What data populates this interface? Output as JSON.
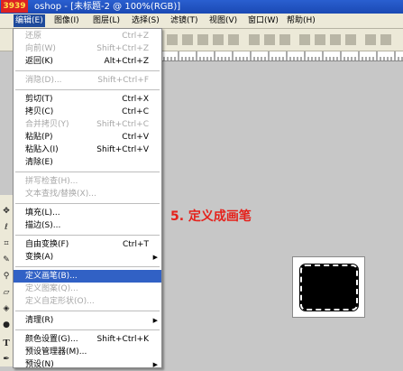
{
  "window": {
    "badge": "3939",
    "title": "oshop - [未标题-2 @ 100%(RGB)]"
  },
  "menubar": [
    {
      "label": "编辑(E)",
      "active": true
    },
    {
      "label": "图像(I)"
    },
    {
      "label": "图层(L)"
    },
    {
      "label": "选择(S)"
    },
    {
      "label": "滤镜(T)"
    },
    {
      "label": "视图(V)"
    },
    {
      "label": "窗口(W)"
    },
    {
      "label": "帮助(H)"
    }
  ],
  "edit_menu": {
    "items": [
      {
        "label": "还原",
        "shortcut": "Ctrl+Z",
        "disabled": true
      },
      {
        "label": "向前(W)",
        "shortcut": "Shift+Ctrl+Z",
        "disabled": true
      },
      {
        "label": "返回(K)",
        "shortcut": "Alt+Ctrl+Z"
      },
      {
        "label": "消隐(D)...",
        "shortcut": "Shift+Ctrl+F",
        "disabled": true
      },
      {
        "label": "剪切(T)",
        "shortcut": "Ctrl+X"
      },
      {
        "label": "拷贝(C)",
        "shortcut": "Ctrl+C"
      },
      {
        "label": "合并拷贝(Y)",
        "shortcut": "Shift+Ctrl+C",
        "disabled": true
      },
      {
        "label": "粘贴(P)",
        "shortcut": "Ctrl+V"
      },
      {
        "label": "粘贴入(I)",
        "shortcut": "Shift+Ctrl+V"
      },
      {
        "label": "清除(E)",
        "shortcut": ""
      },
      {
        "label": "拼写检查(H)...",
        "shortcut": "",
        "disabled": true
      },
      {
        "label": "文本查找/替换(X)...",
        "shortcut": "",
        "disabled": true
      },
      {
        "label": "填充(L)...",
        "shortcut": ""
      },
      {
        "label": "描边(S)...",
        "shortcut": ""
      },
      {
        "label": "自由变换(F)",
        "shortcut": "Ctrl+T"
      },
      {
        "label": "变换(A)",
        "shortcut": "",
        "submenu": true
      },
      {
        "label": "定义画笔(B)...",
        "shortcut": "",
        "highlighted": true
      },
      {
        "label": "定义图案(Q)...",
        "shortcut": "",
        "disabled": true
      },
      {
        "label": "定义自定形状(O)...",
        "shortcut": "",
        "disabled": true
      },
      {
        "label": "清理(R)",
        "shortcut": "",
        "submenu": true
      },
      {
        "label": "颜色设置(G)...",
        "shortcut": "Shift+Ctrl+K"
      },
      {
        "label": "预设管理器(M)...",
        "shortcut": ""
      },
      {
        "label": "预设(N)",
        "shortcut": "",
        "submenu": true
      }
    ]
  },
  "caption": "5. 定义成画笔",
  "colors": {
    "highlight": "#3161c5",
    "caption": "#e5211b",
    "disabled": "#a7a7a7"
  },
  "icons": [
    "move-icon",
    "lasso-icon",
    "crop-icon",
    "brush-icon",
    "stamp-icon",
    "eraser-icon",
    "bucket-icon",
    "dodge-icon",
    "text-icon",
    "pen-icon"
  ]
}
